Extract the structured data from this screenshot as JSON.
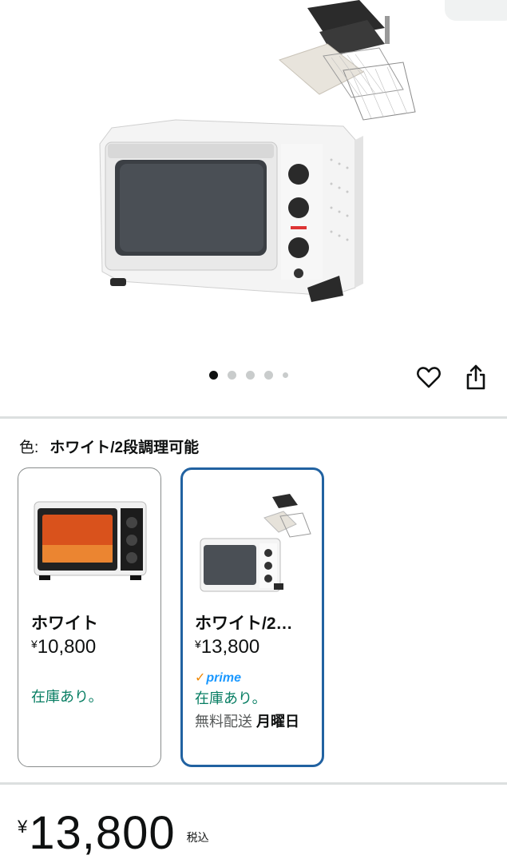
{
  "gallery": {
    "image_alt": "toaster-oven-with-accessories",
    "dots_total": 5,
    "dots_active": 1,
    "heart_icon": "heart-outline",
    "share_icon": "share-upload"
  },
  "variation": {
    "label": "色:",
    "selected": "ホワイト/2段調理可能"
  },
  "cards": [
    {
      "name": "ホワイト",
      "currency": "¥",
      "price": "10,800",
      "stock": "在庫あり。",
      "selected": false
    },
    {
      "name": "ホワイト/2…",
      "currency": "¥",
      "price": "13,800",
      "prime": "prime",
      "stock": "在庫あり。",
      "ship_prefix": "無料配送",
      "ship_day": "月曜日",
      "selected": true
    }
  ],
  "price": {
    "currency": "¥",
    "amount": "13,800",
    "tax": "税込"
  },
  "colors": {
    "accent_border": "#2162a1",
    "stock_green": "#067d62",
    "prime_blue": "#1a98ff",
    "prime_check": "#f08804"
  }
}
